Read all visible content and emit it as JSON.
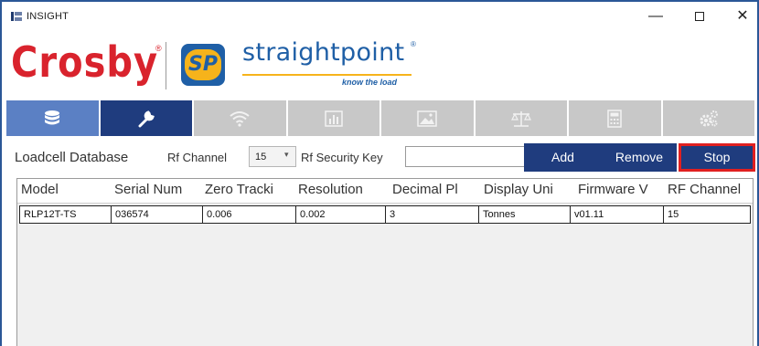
{
  "window": {
    "title": "INSIGHT",
    "controls": {
      "minimize": "—",
      "close": "✕"
    }
  },
  "branding": {
    "crosby": "Crosby",
    "crosby_mark": "®",
    "straightpoint": "straightpoint",
    "straightpoint_mark": "®",
    "sp_badge": "SP",
    "tagline": "know the load"
  },
  "toolbar": {
    "tabs": [
      {
        "icon": "database-icon",
        "state": "selected"
      },
      {
        "icon": "wrench-icon",
        "state": "active"
      },
      {
        "icon": "wifi-icon",
        "state": "normal"
      },
      {
        "icon": "bar-chart-icon",
        "state": "normal"
      },
      {
        "icon": "image-icon",
        "state": "normal"
      },
      {
        "icon": "scales-icon",
        "state": "normal"
      },
      {
        "icon": "calculator-icon",
        "state": "normal"
      },
      {
        "icon": "gears-icon",
        "state": "normal"
      }
    ],
    "colors": {
      "active": "#1f3c7e",
      "selected": "#5b80c4",
      "normal": "#c8c8c8"
    }
  },
  "controls": {
    "db_label": "Loadcell Database",
    "rf_channel_label": "Rf Channel",
    "rf_channel_value": "15",
    "rf_security_label": "Rf Security Key",
    "rf_security_value": "",
    "add_label": "Add",
    "remove_label": "Remove",
    "stop_label": "Stop"
  },
  "table": {
    "columns": [
      "Model",
      "Serial Num",
      "Zero Tracki",
      "Resolution",
      "Decimal Pl",
      "Display Uni",
      "Firmware V",
      "RF Channel"
    ],
    "rows": [
      [
        "RLP12T-TS",
        "036574",
        "0.006",
        "0.002",
        "3",
        "Tonnes",
        "v01.11",
        "15"
      ]
    ]
  },
  "colors": {
    "accent": "#1f3c7e",
    "highlight": "#e02020",
    "brand_red": "#d9232d",
    "brand_blue": "#1f5fa6",
    "brand_yellow": "#f6b31b"
  }
}
